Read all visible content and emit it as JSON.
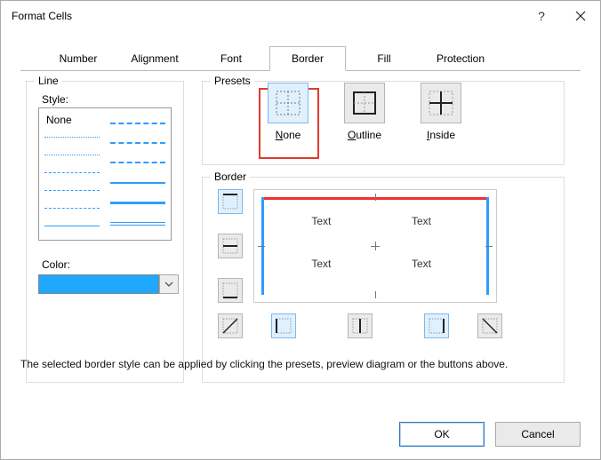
{
  "window": {
    "title": "Format Cells"
  },
  "tabs": {
    "items": [
      "Number",
      "Alignment",
      "Font",
      "Border",
      "Fill",
      "Protection"
    ],
    "active": "Border"
  },
  "line": {
    "group_label": "Line",
    "style_label": "Style:",
    "none_label": "None",
    "color_label": "Color:",
    "color_value": "#1ea8ff"
  },
  "presets": {
    "group_label": "Presets",
    "items": [
      {
        "key": "none",
        "label": "None",
        "mnemonic": "N",
        "selected": true
      },
      {
        "key": "outline",
        "label": "Outline",
        "mnemonic": "O",
        "selected": false
      },
      {
        "key": "inside",
        "label": "Inside",
        "mnemonic": "I",
        "selected": false
      }
    ]
  },
  "border": {
    "group_label": "Border",
    "side_buttons": {
      "top": true,
      "middle_h": false,
      "bottom": false,
      "diag_down": false,
      "left": true,
      "center_v": false,
      "right": true,
      "diag_up": false
    },
    "preview_cells": [
      [
        "Text",
        "Text"
      ],
      [
        "Text",
        "Text"
      ]
    ],
    "preview_edges": {
      "top_color": "#f03030",
      "left_color": "#2f9cff",
      "right_color": "#2f9cff"
    }
  },
  "info_text": "The selected border style can be applied by clicking the presets, preview diagram or the buttons above.",
  "buttons": {
    "ok": "OK",
    "cancel": "Cancel"
  }
}
